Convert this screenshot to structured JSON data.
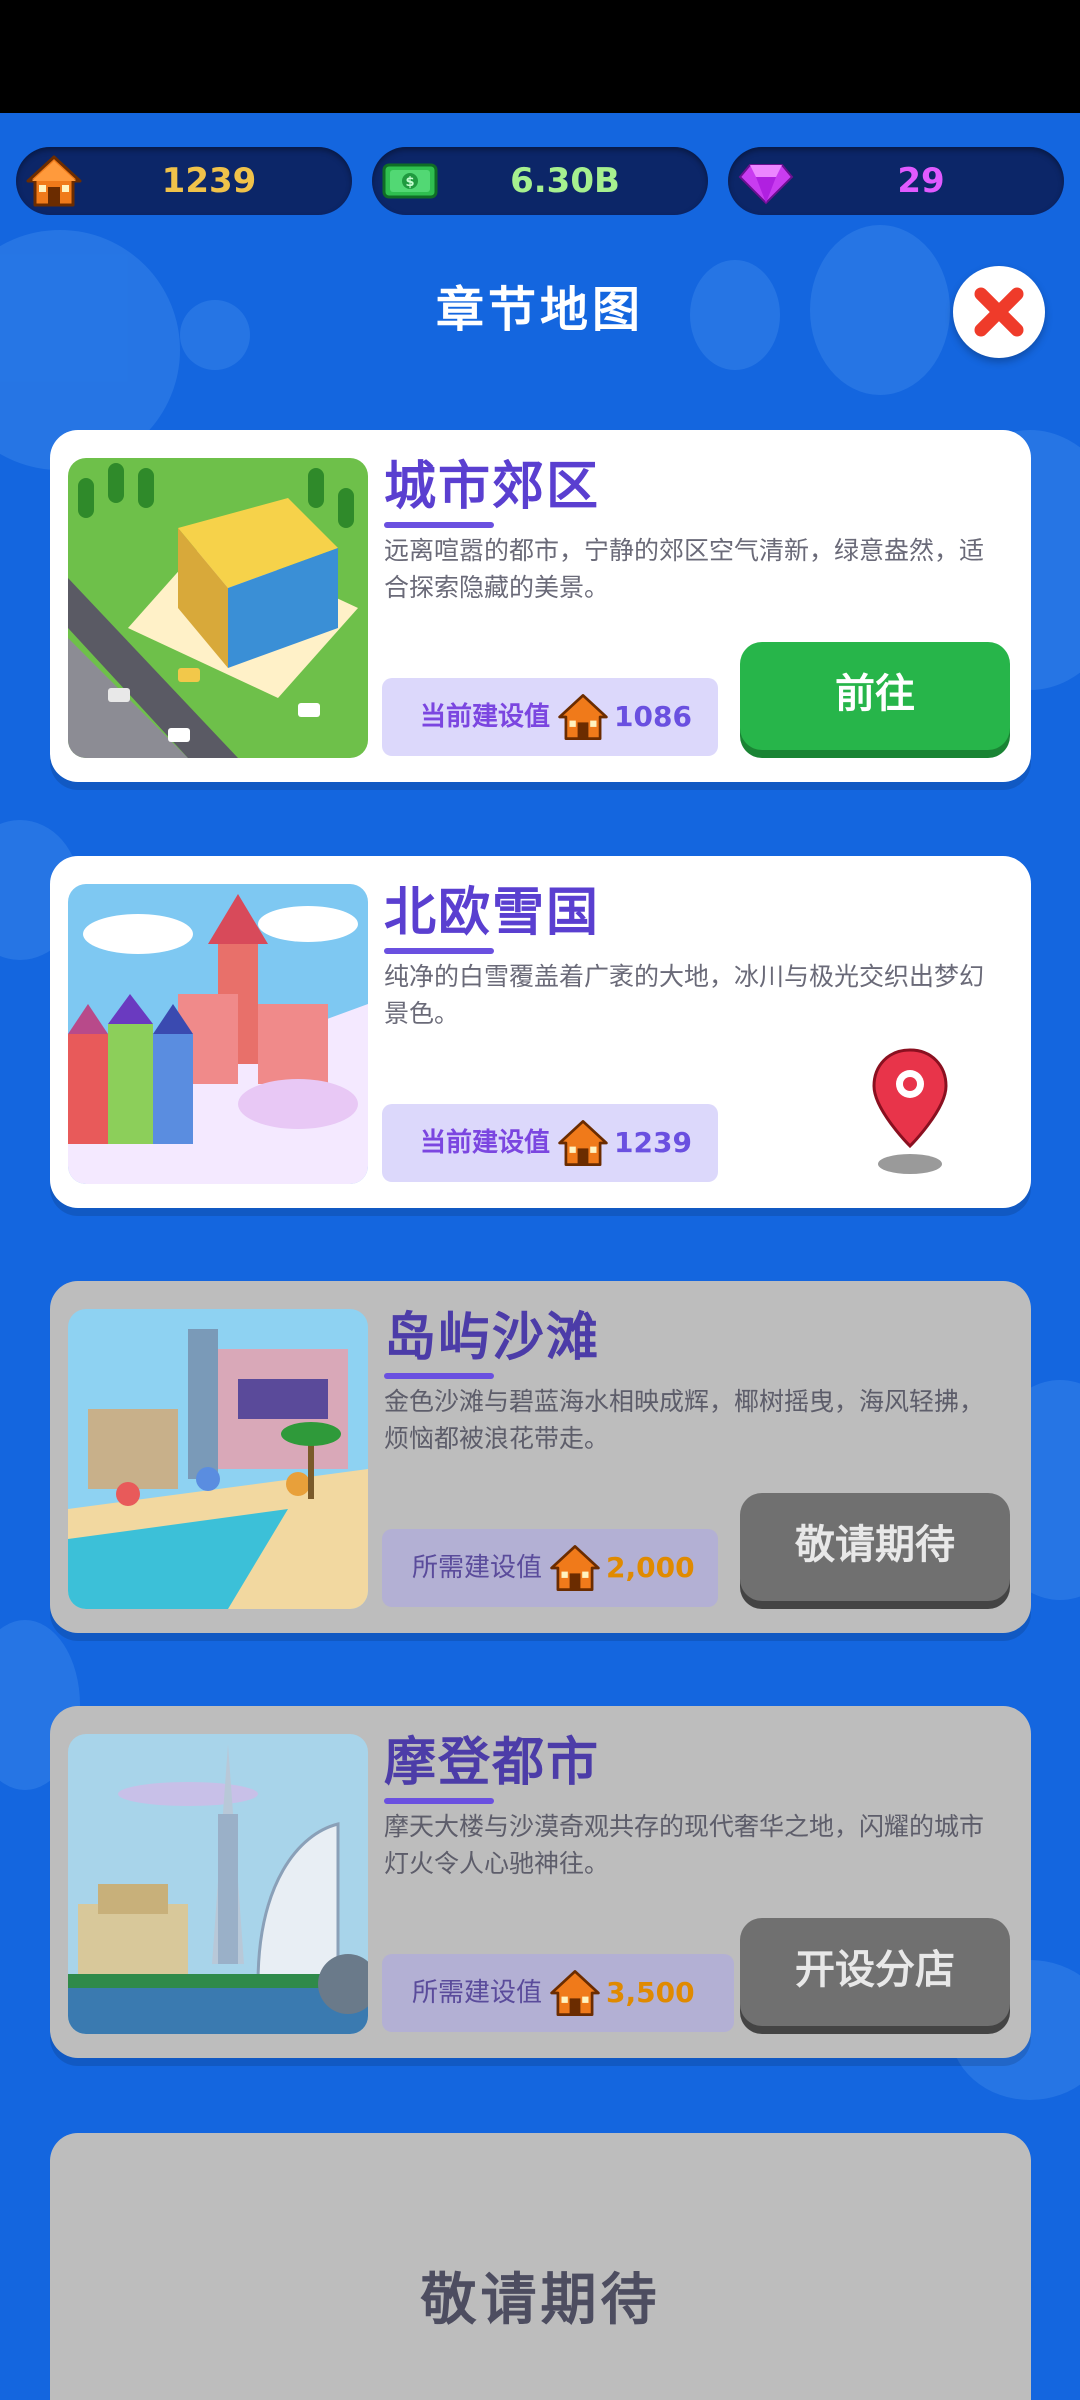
{
  "resources": {
    "houses": {
      "icon": "house-icon",
      "value": "1239",
      "color": "#f0c24a"
    },
    "cash": {
      "icon": "cash-icon",
      "value": "6.30B",
      "color": "#a6f08f"
    },
    "gems": {
      "icon": "gem-icon",
      "value": "29",
      "color": "#e05aff"
    }
  },
  "header": {
    "title": "章节地图",
    "close_icon": "close-icon"
  },
  "chapters": [
    {
      "title": "城市郊区",
      "description": "远离喧嚣的都市，宁静的郊区空气清新，绿意盎然，适合探索隐藏的美景。",
      "value_label": "当前建设值",
      "value": "1086",
      "button": "前往",
      "state": "unlocked"
    },
    {
      "title": "北欧雪国",
      "description": "纯净的白雪覆盖着广袤的大地，冰川与极光交织出梦幻景色。",
      "value_label": "当前建设值",
      "value": "1239",
      "marker_icon": "location-pin-icon",
      "state": "current"
    },
    {
      "title": "岛屿沙滩",
      "description": "金色沙滩与碧蓝海水相映成辉，椰树摇曳，海风轻拂，烦恼都被浪花带走。",
      "value_label": "所需建设值",
      "value": "2,000",
      "button": "敬请期待",
      "state": "locked"
    },
    {
      "title": "摩登都市",
      "description": "摩天大楼与沙漠奇观共存的现代奢华之地，闪耀的城市灯火令人心驰神往。",
      "value_label": "所需建设值",
      "value": "3,500",
      "button": "开设分店",
      "state": "locked"
    }
  ],
  "coming_soon": {
    "label": "敬请期待"
  }
}
